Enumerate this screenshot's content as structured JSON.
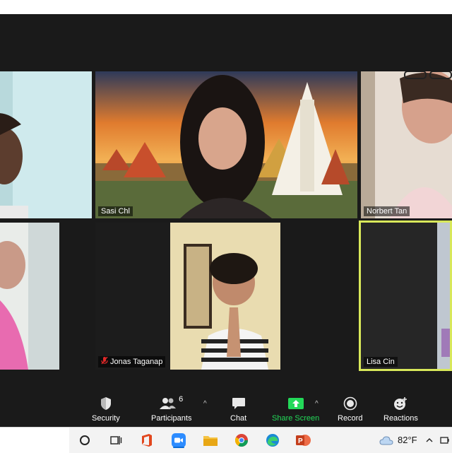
{
  "participants": [
    {
      "name": ""
    },
    {
      "name": "Sasi Chl"
    },
    {
      "name": "Norbert Tan"
    },
    {
      "name": ""
    },
    {
      "name": "Jonas Taganap",
      "muted": true
    },
    {
      "name": "Lisa Cin"
    }
  ],
  "toolbar": {
    "security_label": "Security",
    "participants_label": "Participants",
    "participants_count": "6",
    "chat_label": "Chat",
    "share_label": "Share Screen",
    "record_label": "Record",
    "reactions_label": "Reactions"
  },
  "taskbar": {
    "weather_temp": "82°F",
    "apps": [
      "cortana-icon",
      "task-view-icon",
      "office-icon",
      "zoom-icon",
      "file-explorer-icon",
      "chrome-icon",
      "edge-icon",
      "powerpoint-icon"
    ]
  },
  "colors": {
    "active_speaker_border": "#d8e85a",
    "share_green": "#23d959",
    "toolbar_bg": "#1a1a1a",
    "muted_red": "#e02828"
  }
}
